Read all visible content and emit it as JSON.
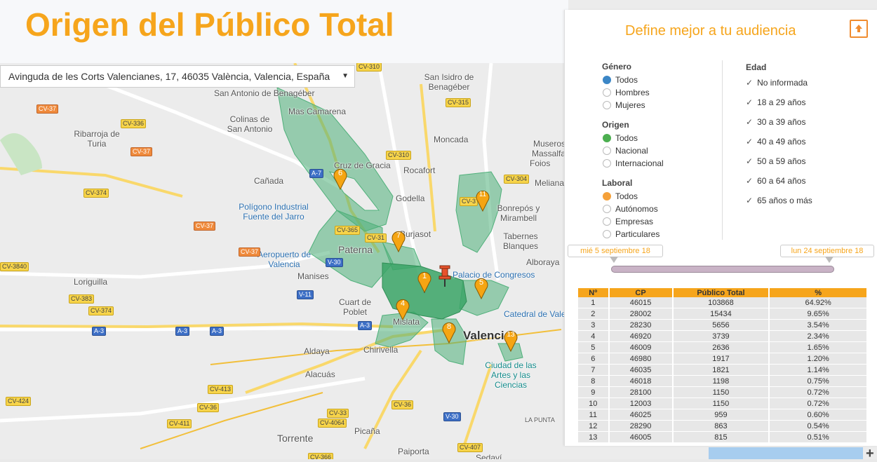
{
  "header": {
    "title": "Origen del Público Total"
  },
  "address": {
    "value": "Avinguda de les Corts Valencianes, 17, 46035 València, Valencia, España",
    "arrow": "▼"
  },
  "map": {
    "places": [
      "San Antonio de Benagéber",
      "Mas Camarena",
      "Colinas de San Antonio",
      "Ribarroja de Turia",
      "San Isidro de Benagéber",
      "Moncada",
      "Cruz de Gracia",
      "Rocafort",
      "Cañada",
      "Godella",
      "Polígono Industrial Fuente del Jarro",
      "Paterna",
      "Burjasot",
      "Aeropuerto de Valencia",
      "Manises",
      "Loriguilla",
      "Cuart de Poblet",
      "Mislata",
      "Aldaya",
      "Chirivella",
      "Alacuás",
      "Valencia",
      "Palacio de Congresos",
      "Catedral de Valencia",
      "Ciudad de las Artes y las Ciencias",
      "Torrente",
      "Picaña",
      "Paiporta",
      "Sedaví",
      "Foios",
      "Meliana",
      "Bonrepós y Mirambell",
      "Tabernes Blanques",
      "Alboraya",
      "Museros",
      "Massalfassar",
      "LA PUNTA"
    ],
    "roads": [
      "CV-37",
      "CV-336",
      "CV-374",
      "CV-310",
      "CV-315",
      "CV-304",
      "CV-3",
      "CV-365",
      "CV-31",
      "CV-383",
      "CV-3840",
      "CV-413",
      "CV-424",
      "CV-411",
      "CV-36",
      "CV-33",
      "CV-4064",
      "CV-407",
      "CV-366",
      "A-7",
      "A-3",
      "V-30",
      "V-11"
    ],
    "markers": [
      "1",
      "4",
      "5",
      "6",
      "7",
      "8",
      "11",
      "13"
    ]
  },
  "panel": {
    "title": "Define mejor a tu audiencia",
    "export_icon": "upload-icon",
    "genero": {
      "title": "Género",
      "options": [
        "Todos",
        "Hombres",
        "Mujeres"
      ],
      "color": "#3b86c6"
    },
    "origen": {
      "title": "Origen",
      "options": [
        "Todos",
        "Nacional",
        "Internacional"
      ],
      "color": "#4caf50"
    },
    "laboral": {
      "title": "Laboral",
      "options": [
        "Todos",
        "Autónomos",
        "Empresas",
        "Particulares"
      ],
      "color": "#f5a13a"
    },
    "edad": {
      "title": "Edad",
      "options": [
        "No informada",
        "18 a 29 años",
        "30 a 39 años",
        "40 a 49 años",
        "50 a 59 años",
        "60 a 64 años",
        "65 años o más"
      ]
    },
    "date_start": "mié 5 septiembre 18",
    "date_end": "lun 24 septiembre 18"
  },
  "table": {
    "headers": [
      "Nº",
      "CP",
      "Público Total",
      "%"
    ],
    "rows": [
      [
        "1",
        "46015",
        "103868",
        "64.92%"
      ],
      [
        "2",
        "28002",
        "15434",
        "9.65%"
      ],
      [
        "3",
        "28230",
        "5656",
        "3.54%"
      ],
      [
        "4",
        "46920",
        "3739",
        "2.34%"
      ],
      [
        "5",
        "46009",
        "2636",
        "1.65%"
      ],
      [
        "6",
        "46980",
        "1917",
        "1.20%"
      ],
      [
        "7",
        "46035",
        "1821",
        "1.14%"
      ],
      [
        "8",
        "46018",
        "1198",
        "0.75%"
      ],
      [
        "9",
        "28100",
        "1150",
        "0.72%"
      ],
      [
        "10",
        "12003",
        "1150",
        "0.72%"
      ],
      [
        "11",
        "46025",
        "959",
        "0.60%"
      ],
      [
        "12",
        "28290",
        "863",
        "0.54%"
      ],
      [
        "13",
        "46005",
        "815",
        "0.51%"
      ]
    ]
  },
  "colors": {
    "accent": "#f6a51c",
    "zone_fill": "#4fb07a",
    "marker": "#f5a513"
  }
}
